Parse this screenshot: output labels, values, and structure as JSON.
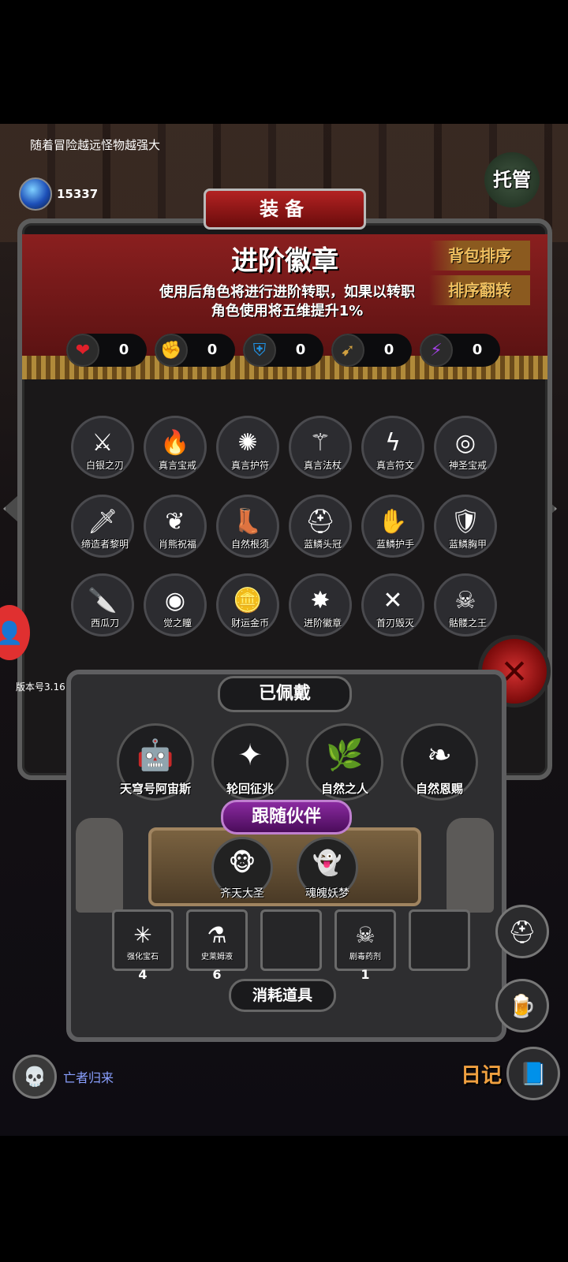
{
  "hud": {
    "tip": "随着冒险越远怪物越强大",
    "gem_value": "15337",
    "gem_caption": "宝石",
    "auto_button": "托管",
    "version": "版本号3.16"
  },
  "panel": {
    "title": "装备",
    "item_name": "进阶徽章",
    "item_desc_line1": "使用后角色将进行进阶转职，如果以转职",
    "item_desc_line2": "角色使用将五维提升1%",
    "sort_button": "背包排序",
    "reverse_button": "排序翻转",
    "stats": [
      {
        "icon": "heart-icon",
        "glyph": "❤",
        "value": "0",
        "color": "#e0202a"
      },
      {
        "icon": "strength-icon",
        "glyph": "✊",
        "value": "0",
        "color": "#e0c020"
      },
      {
        "icon": "armor-icon",
        "glyph": "⛨",
        "value": "0",
        "color": "#2090e0"
      },
      {
        "icon": "agility-icon",
        "glyph": "➹",
        "value": "0",
        "color": "#d0a040"
      },
      {
        "icon": "magic-icon",
        "glyph": "⚡",
        "value": "0",
        "color": "#a040e0"
      }
    ],
    "items": [
      {
        "name": "白银之刃",
        "icon": "sword-icon",
        "glyph": "⚔"
      },
      {
        "name": "真言宝戒",
        "icon": "ring-icon",
        "glyph": "🔥"
      },
      {
        "name": "真言护符",
        "icon": "amulet-icon",
        "glyph": "✺"
      },
      {
        "name": "真言法杖",
        "icon": "staff-icon",
        "glyph": "⚚"
      },
      {
        "name": "真言符文",
        "icon": "rune-icon",
        "glyph": "ϟ"
      },
      {
        "name": "神圣宝戒",
        "icon": "ring-icon",
        "glyph": "◎"
      },
      {
        "name": "缔造者黎明",
        "icon": "sword-icon",
        "glyph": "🗡"
      },
      {
        "name": "肖熊祝福",
        "icon": "necklace-icon",
        "glyph": "❦"
      },
      {
        "name": "自然根须",
        "icon": "boots-icon",
        "glyph": "👢"
      },
      {
        "name": "蓝鳞头冠",
        "icon": "helmet-icon",
        "glyph": "⛑"
      },
      {
        "name": "蓝鳞护手",
        "icon": "gauntlet-icon",
        "glyph": "✋"
      },
      {
        "name": "蓝鳞胸甲",
        "icon": "chestplate-icon",
        "glyph": "🛡"
      },
      {
        "name": "西瓜刀",
        "icon": "knife-icon",
        "glyph": "🔪"
      },
      {
        "name": "觉之瞳",
        "icon": "eye-icon",
        "glyph": "◉"
      },
      {
        "name": "财运金币",
        "icon": "coin-icon",
        "glyph": "🪙"
      },
      {
        "name": "进阶徽章",
        "icon": "badge-icon",
        "glyph": "✸"
      },
      {
        "name": "首刃毁灭",
        "icon": "blade-icon",
        "glyph": "✕"
      },
      {
        "name": "骷髅之王",
        "icon": "skull-icon",
        "glyph": "☠"
      }
    ]
  },
  "equipped": {
    "title": "已佩戴",
    "items": [
      {
        "name": "天穹号阿宙斯",
        "icon": "robot-icon",
        "glyph": "🤖"
      },
      {
        "name": "轮回征兆",
        "icon": "orb-icon",
        "glyph": "✦"
      },
      {
        "name": "自然之人",
        "icon": "treant-icon",
        "glyph": "🌿"
      },
      {
        "name": "自然恩赐",
        "icon": "leaf-icon",
        "glyph": "❧"
      }
    ]
  },
  "companions": {
    "title": "跟随伙伴",
    "items": [
      {
        "name": "齐天大圣",
        "icon": "monkey-icon",
        "glyph": "🐵"
      },
      {
        "name": "魂魄妖梦",
        "icon": "ghost-girl-icon",
        "glyph": "👻"
      }
    ]
  },
  "consumables": {
    "title": "消耗道具",
    "slots": [
      {
        "name": "强化宝石",
        "count": "4",
        "icon": "gem-icon",
        "glyph": "✳"
      },
      {
        "name": "史莱姆液",
        "count": "6",
        "icon": "potion-icon",
        "glyph": "⚗"
      },
      {
        "name": "",
        "count": "",
        "icon": "",
        "glyph": ""
      },
      {
        "name": "剧毒药剂",
        "count": "1",
        "icon": "poison-icon",
        "glyph": "☠"
      },
      {
        "name": "",
        "count": "",
        "icon": "",
        "glyph": ""
      }
    ]
  },
  "footer": {
    "return_text": "亡者归来",
    "diary": "日记"
  }
}
